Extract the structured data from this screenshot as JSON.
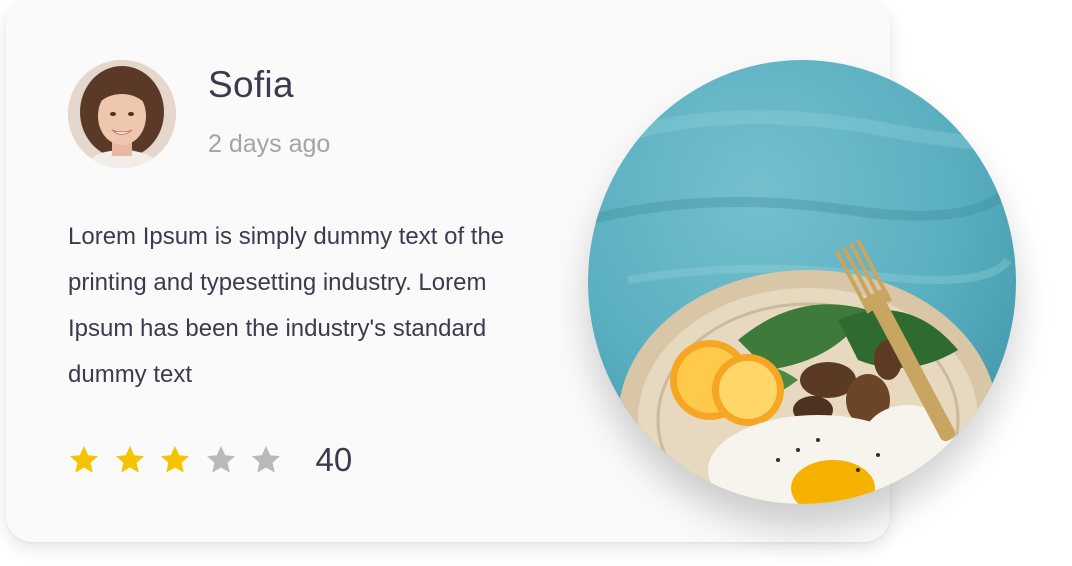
{
  "review": {
    "user": {
      "name": "Sofia",
      "time": "2 days ago",
      "avatar_icon": "user-avatar"
    },
    "text": "Lorem Ipsum is simply dummy text of the printing and typesetting industry. Lorem Ipsum has been the industry's standard dummy text",
    "rating": {
      "stars": 3,
      "max": 5,
      "count": "40"
    },
    "image_icon": "food-bowl-image"
  },
  "colors": {
    "card_bg": "#fafafa",
    "text_dark": "#3d3a4e",
    "text_muted": "#a3a3a8",
    "star_active": "#f5c300",
    "star_inactive": "#b9b9bc",
    "image_bg": "#5fb3c4"
  }
}
